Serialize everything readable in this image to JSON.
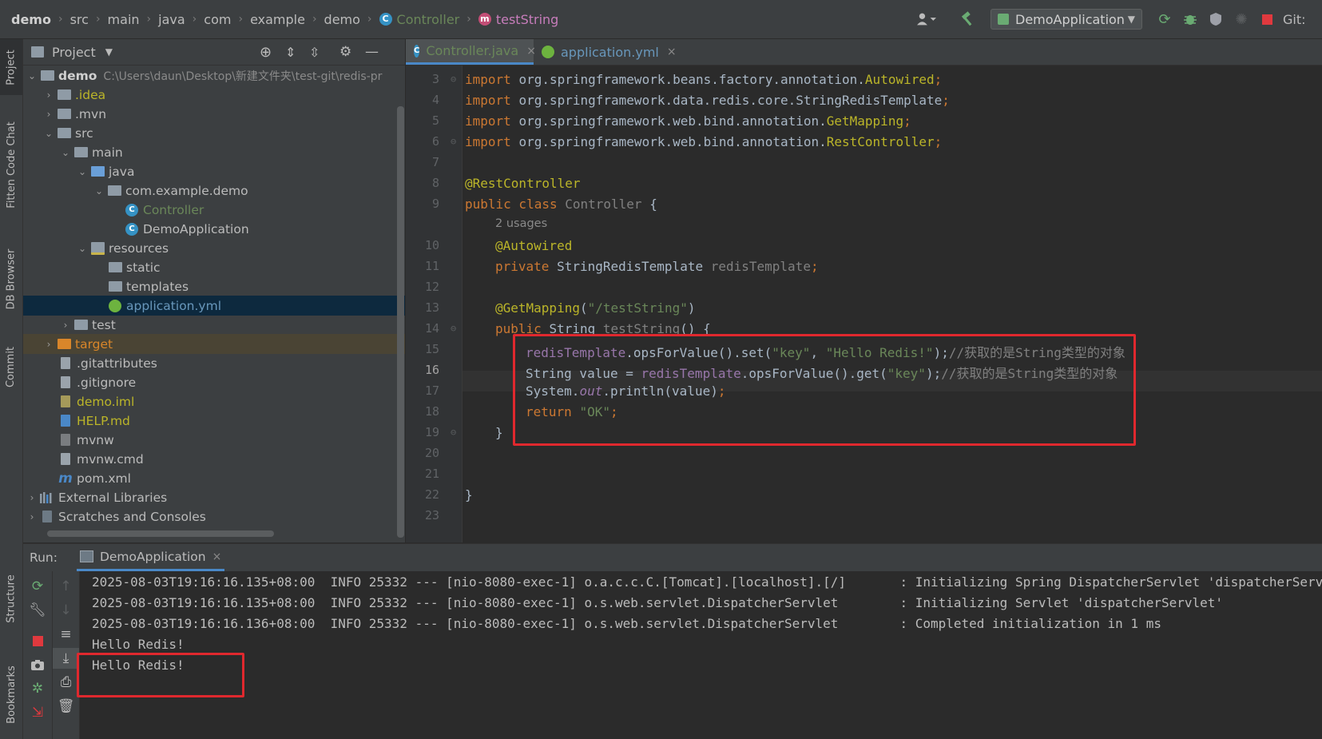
{
  "breadcrumb": {
    "items": [
      "demo",
      "src",
      "main",
      "java",
      "com",
      "example",
      "demo"
    ],
    "class_name": "Controller",
    "method_name": "testString"
  },
  "toolbar": {
    "run_config": "DemoApplication",
    "vcs_label": "Git:"
  },
  "left_stripe": {
    "project": "Project",
    "fitten": "Fitten Code Chat",
    "db_browser": "DB Browser",
    "commit": "Commit",
    "structure": "Structure",
    "bookmarks": "Bookmarks"
  },
  "project_panel": {
    "title": "Project",
    "tree": [
      {
        "label": "demo",
        "path": "C:\\Users\\daun\\Desktop\\新建文件夹\\test-git\\redis-pr"
      },
      {
        "label": ".idea"
      },
      {
        "label": ".mvn"
      },
      {
        "label": "src"
      },
      {
        "label": "main"
      },
      {
        "label": "java"
      },
      {
        "label": "com.example.demo"
      },
      {
        "label": "Controller"
      },
      {
        "label": "DemoApplication"
      },
      {
        "label": "resources"
      },
      {
        "label": "static"
      },
      {
        "label": "templates"
      },
      {
        "label": "application.yml"
      },
      {
        "label": "test"
      },
      {
        "label": "target"
      },
      {
        "label": ".gitattributes"
      },
      {
        "label": ".gitignore"
      },
      {
        "label": "demo.iml"
      },
      {
        "label": "HELP.md"
      },
      {
        "label": "mvnw"
      },
      {
        "label": "mvnw.cmd"
      },
      {
        "label": "pom.xml"
      },
      {
        "label": "External Libraries"
      },
      {
        "label": "Scratches and Consoles"
      }
    ]
  },
  "editor_tabs": [
    {
      "label": "Controller.java",
      "close": "×"
    },
    {
      "label": "application.yml",
      "close": "×"
    }
  ],
  "editor": {
    "line_numbers": [
      "3",
      "4",
      "5",
      "6",
      "7",
      "8",
      "9",
      "10",
      "11",
      "12",
      "13",
      "14",
      "15",
      "16",
      "17",
      "18",
      "19",
      "20",
      "21",
      "22",
      "23"
    ],
    "usages_hint": "2 usages",
    "code": {
      "l3": [
        "import ",
        "org.springframework.beans.factory.annotation.",
        "Autowired",
        ";"
      ],
      "l4": [
        "import ",
        "org.springframework.data.redis.core.StringRedisTemplate",
        ";"
      ],
      "l5": [
        "import ",
        "org.springframework.web.bind.annotation.",
        "GetMapping",
        ";"
      ],
      "l6": [
        "import ",
        "org.springframework.web.bind.annotation.",
        "RestController",
        ";"
      ],
      "l8": [
        "@RestController"
      ],
      "l9": [
        "public class ",
        "Controller",
        " {"
      ],
      "l10": [
        "@Autowired"
      ],
      "l11": [
        "private ",
        "StringRedisTemplate ",
        "redisTemplate",
        ";"
      ],
      "l13": [
        "@GetMapping",
        "(",
        "\"/testString\"",
        ")"
      ],
      "l14": [
        "public ",
        "String ",
        "testString",
        "() {"
      ],
      "l15": [
        "redisTemplate",
        ".opsForValue().set(",
        "\"key\"",
        ", ",
        "\"Hello Redis!\"",
        ");",
        "//获取的是String类型的对象"
      ],
      "l16": [
        "String value = ",
        "redisTemplate",
        ".opsForValue().get(",
        "\"key\"",
        ");",
        "//获取的是String类型的对象"
      ],
      "l17": [
        "System.",
        "out",
        ".println(value)",
        ";"
      ],
      "l18": [
        "return ",
        "\"OK\"",
        ";"
      ],
      "l19": [
        "}"
      ],
      "l22": [
        "}"
      ]
    }
  },
  "run_panel": {
    "label": "Run:",
    "tab": "DemoApplication",
    "close": "×",
    "console_lines": [
      "2025-08-03T19:16:16.135+08:00  INFO 25332 --- [nio-8080-exec-1] o.a.c.c.C.[Tomcat].[localhost].[/]       : Initializing Spring DispatcherServlet 'dispatcherServlet'",
      "2025-08-03T19:16:16.135+08:00  INFO 25332 --- [nio-8080-exec-1] o.s.web.servlet.DispatcherServlet        : Initializing Servlet 'dispatcherServlet'",
      "2025-08-03T19:16:16.136+08:00  INFO 25332 --- [nio-8080-exec-1] o.s.web.servlet.DispatcherServlet        : Completed initialization in 1 ms",
      "Hello Redis!",
      "Hello Redis!"
    ]
  },
  "colors": {
    "highlight_box": "#e0282e",
    "accent_blue": "#4a88c7"
  }
}
